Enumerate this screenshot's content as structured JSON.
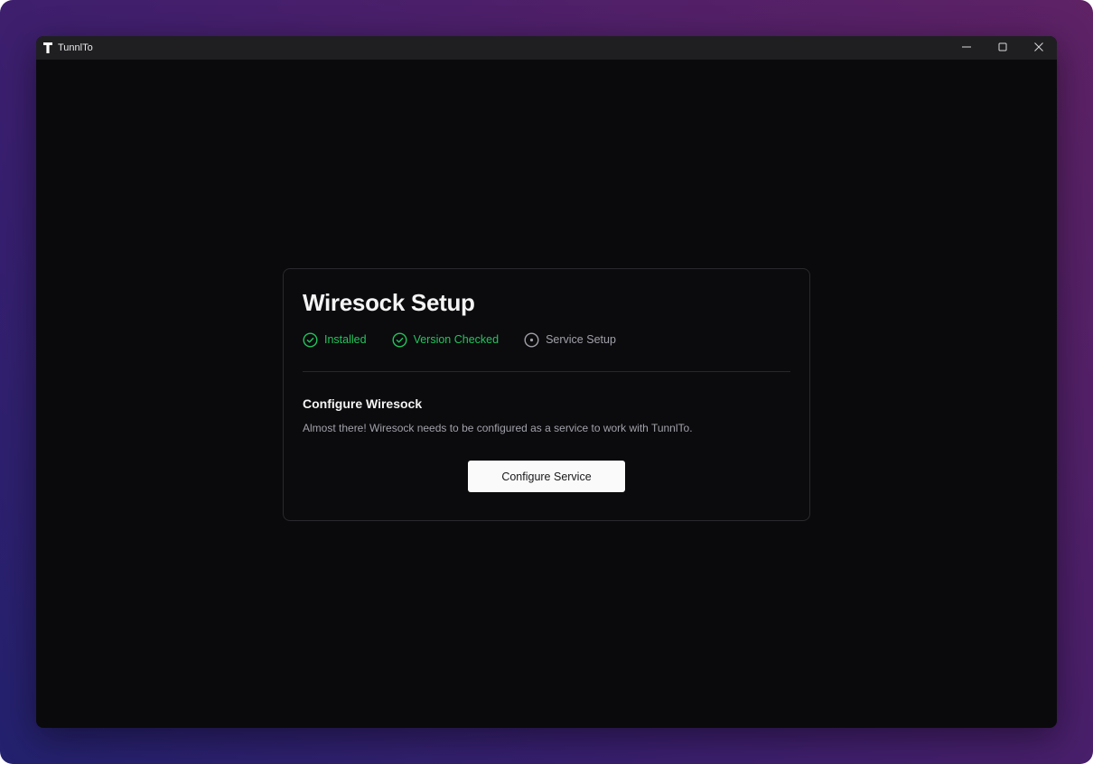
{
  "window": {
    "title": "TunnlTo",
    "controls": {
      "minimize_icon": "minimize-icon",
      "maximize_icon": "maximize-icon",
      "close_icon": "close-icon"
    }
  },
  "setup": {
    "title": "Wiresock Setup",
    "steps": [
      {
        "label": "Installed",
        "status": "complete",
        "icon": "check-circle-icon",
        "color": "#22c55e"
      },
      {
        "label": "Version Checked",
        "status": "complete",
        "icon": "check-circle-icon",
        "color": "#22c55e"
      },
      {
        "label": "Service Setup",
        "status": "current",
        "icon": "dot-circle-icon",
        "color": "#a1a1aa"
      }
    ],
    "section_title": "Configure Wiresock",
    "section_description": "Almost there! Wiresock needs to be configured as a service to work with TunnlTo.",
    "primary_button_label": "Configure Service"
  },
  "colors": {
    "accent_success": "#22c55e",
    "background": "#0a0a0c",
    "titlebar": "#1f1f22",
    "button_bg": "#fafafa"
  }
}
